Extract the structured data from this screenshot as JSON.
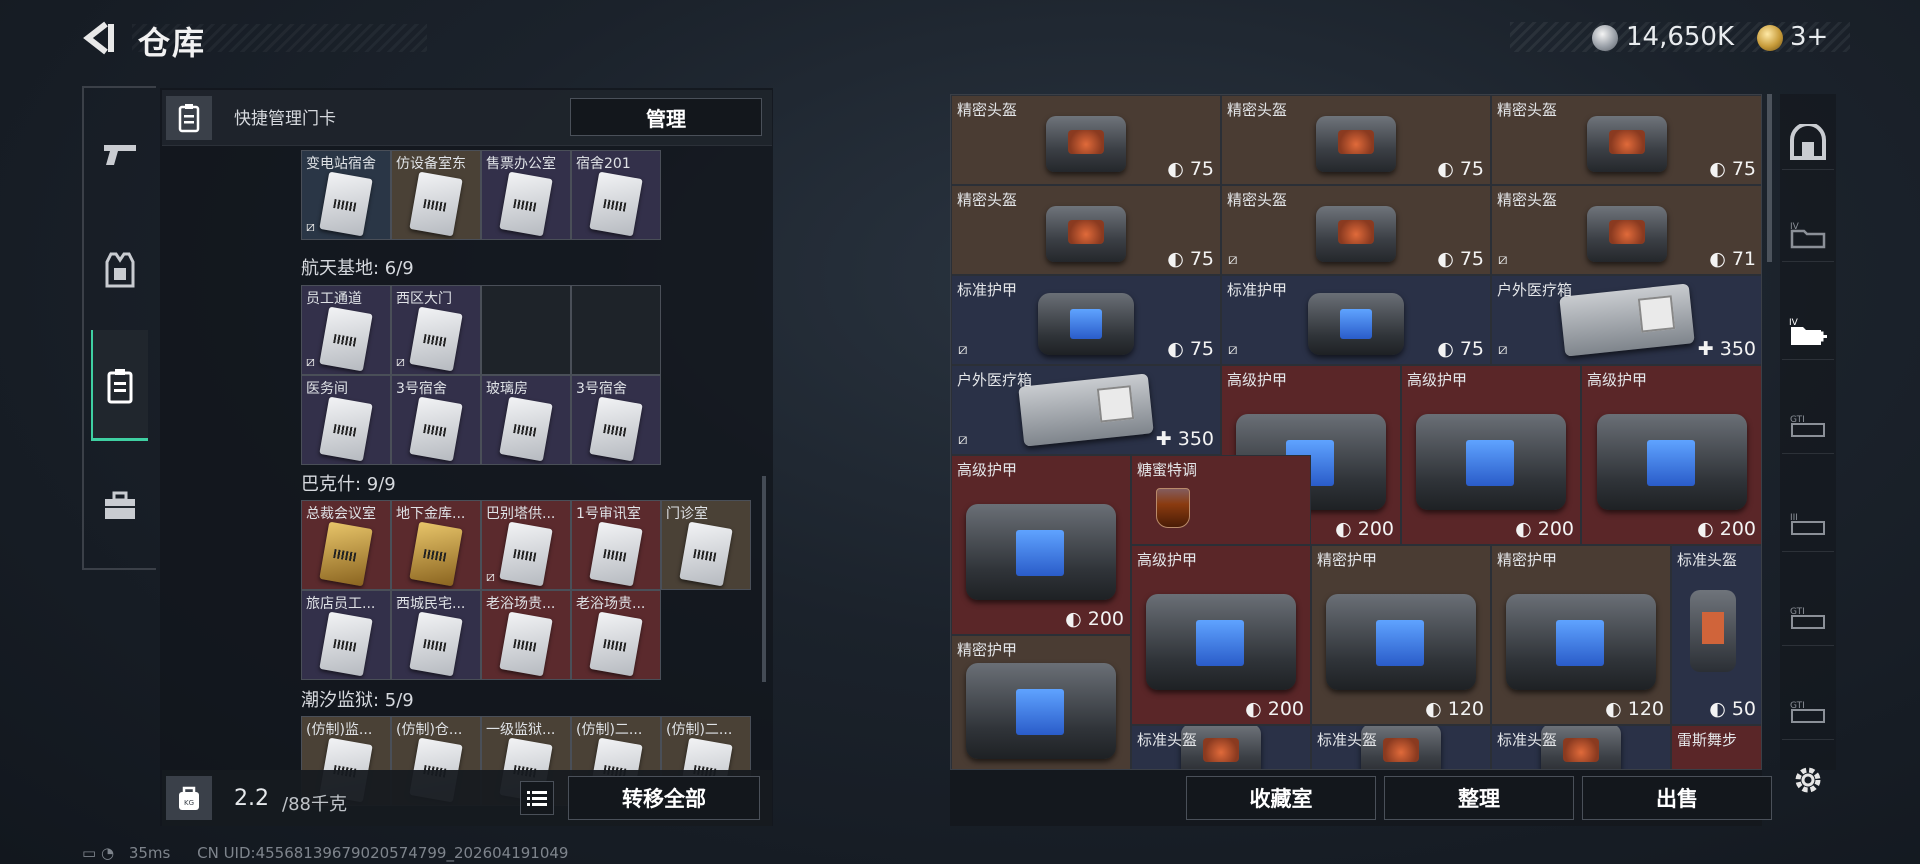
{
  "header": {
    "title": "仓库",
    "money": "14,650K",
    "tickets": "3+"
  },
  "nav": {
    "items": [
      "weapon",
      "armor",
      "keycard",
      "toolbox"
    ],
    "active": "keycard"
  },
  "left_panel": {
    "quick_manage": "快捷管理门卡",
    "manage_button": "管理",
    "groups": [
      {
        "title": "",
        "cells": [
          {
            "label": "变电站宿舍",
            "color": "blue",
            "card": "normal",
            "no_insure": true
          },
          {
            "label": "仿设备室东",
            "color": "tan",
            "card": "normal",
            "no_insure": false
          },
          {
            "label": "售票办公室",
            "color": "purple",
            "card": "normal",
            "no_insure": false
          },
          {
            "label": "宿舍201",
            "color": "purple",
            "card": "normal",
            "no_insure": false
          }
        ]
      },
      {
        "title": "航天基地: 6/9",
        "cells": [
          {
            "label": "员工通道",
            "color": "purple",
            "card": "normal",
            "no_insure": true
          },
          {
            "label": "西区大门",
            "color": "purple",
            "card": "normal",
            "no_insure": true
          },
          {
            "label": "",
            "color": "empty"
          },
          {
            "label": "",
            "color": "empty"
          },
          {
            "label": "医务间",
            "color": "purple",
            "card": "normal"
          },
          {
            "label": "3号宿舍",
            "color": "purple",
            "card": "normal"
          },
          {
            "label": "玻璃房",
            "color": "purple",
            "card": "normal"
          },
          {
            "label": "3号宿舍",
            "color": "purple",
            "card": "normal"
          }
        ]
      },
      {
        "title": "巴克什: 9/9",
        "cells": [
          {
            "label": "总裁会议室",
            "color": "red",
            "card": "gold"
          },
          {
            "label": "地下金库...",
            "color": "red",
            "card": "gold"
          },
          {
            "label": "巴别塔供...",
            "color": "red",
            "card": "normal",
            "no_insure": true
          },
          {
            "label": "1号审讯室",
            "color": "red",
            "card": "normal"
          },
          {
            "label": "门诊室",
            "color": "tan",
            "card": "normal"
          },
          {
            "label": "旅店员工...",
            "color": "purple",
            "card": "normal"
          },
          {
            "label": "西城民宅...",
            "color": "purple",
            "card": "normal"
          },
          {
            "label": "老浴场贵...",
            "color": "red",
            "card": "normal"
          },
          {
            "label": "老浴场贵...",
            "color": "red",
            "card": "normal"
          }
        ]
      },
      {
        "title": "潮汐监狱: 5/9",
        "cells": [
          {
            "label": "(仿制)监...",
            "color": "tan",
            "card": "normal"
          },
          {
            "label": "(仿制)仓...",
            "color": "tan",
            "card": "normal"
          },
          {
            "label": "一级监狱...",
            "color": "tan",
            "card": "normal"
          },
          {
            "label": "(仿制)二...",
            "color": "tan",
            "card": "normal"
          },
          {
            "label": "(仿制)二...",
            "color": "tan",
            "card": "normal"
          }
        ]
      }
    ],
    "weight": "2.2",
    "weight_unit": "/88千克",
    "move_all": "转移全部"
  },
  "right_panel": {
    "items": [
      {
        "name": "精密头盔",
        "value": "75",
        "icon": "shield",
        "kind": "helmet",
        "bg": "brown"
      },
      {
        "name": "精密头盔",
        "value": "75",
        "icon": "shield",
        "kind": "helmet",
        "bg": "brown"
      },
      {
        "name": "精密头盔",
        "value": "75",
        "icon": "shield",
        "kind": "helmet",
        "bg": "brown"
      },
      {
        "name": "精密头盔",
        "value": "75",
        "icon": "shield",
        "kind": "helmet",
        "bg": "brown"
      },
      {
        "name": "精密头盔",
        "value": "75",
        "icon": "shield",
        "kind": "helmet",
        "bg": "brown",
        "no_insure": true
      },
      {
        "name": "精密头盔",
        "value": "71",
        "icon": "shield",
        "kind": "helmet",
        "bg": "brown",
        "no_insure": true
      },
      {
        "name": "标准护甲",
        "value": "75",
        "icon": "shield",
        "kind": "vest",
        "bg": "navy",
        "no_insure": true
      },
      {
        "name": "标准护甲",
        "value": "75",
        "icon": "shield",
        "kind": "vest",
        "bg": "navy",
        "no_insure": true
      },
      {
        "name": "户外医疗箱",
        "value": "350",
        "icon": "plus",
        "kind": "medkit",
        "bg": "navy",
        "no_insure": true
      },
      {
        "name": "户外医疗箱",
        "value": "350",
        "icon": "plus",
        "kind": "medkit",
        "bg": "navy",
        "no_insure": true
      },
      {
        "name": "高级护甲",
        "value": "200",
        "icon": "shield",
        "kind": "vest",
        "bg": "maroon"
      },
      {
        "name": "高级护甲",
        "value": "200",
        "icon": "shield",
        "kind": "vest",
        "bg": "maroon"
      },
      {
        "name": "高级护甲",
        "value": "200",
        "icon": "shield",
        "kind": "vest",
        "bg": "maroon"
      },
      {
        "name": "高级护甲",
        "value": "200",
        "icon": "shield",
        "kind": "vest",
        "bg": "maroon"
      },
      {
        "name": "糖蜜特调",
        "value": "",
        "icon": "",
        "kind": "drink",
        "bg": "maroon"
      },
      {
        "name": "高级护甲",
        "value": "200",
        "icon": "shield",
        "kind": "vest",
        "bg": "maroon"
      },
      {
        "name": "精密护甲",
        "value": "120",
        "icon": "shield",
        "kind": "vest",
        "bg": "brown"
      },
      {
        "name": "精密护甲",
        "value": "120",
        "icon": "shield",
        "kind": "vest",
        "bg": "brown"
      },
      {
        "name": "标准头盔",
        "value": "50",
        "icon": "shield",
        "kind": "smallhelm",
        "bg": "navy"
      },
      {
        "name": "精密护甲",
        "value": "",
        "icon": "",
        "kind": "vest",
        "bg": "brown"
      },
      {
        "name": "标准头盔",
        "value": "",
        "icon": "",
        "kind": "helmet",
        "bg": "navy"
      },
      {
        "name": "标准头盔",
        "value": "",
        "icon": "",
        "kind": "helmet",
        "bg": "navy"
      },
      {
        "name": "标准头盔",
        "value": "",
        "icon": "",
        "kind": "helmet",
        "bg": "navy"
      },
      {
        "name": "雷斯舞步",
        "value": "",
        "icon": "",
        "kind": "none",
        "bg": "maroon"
      }
    ],
    "buttons": {
      "collection": "收藏室",
      "organize": "整理",
      "sell": "出售"
    }
  },
  "status": {
    "ping": "35ms",
    "uid": "CN UID:455681396790205747​99_202604191049"
  },
  "colors": {
    "accent": "#3fd0a2",
    "brown": "#4a3c33",
    "navy": "#2a3147",
    "maroon": "#5a2628"
  }
}
